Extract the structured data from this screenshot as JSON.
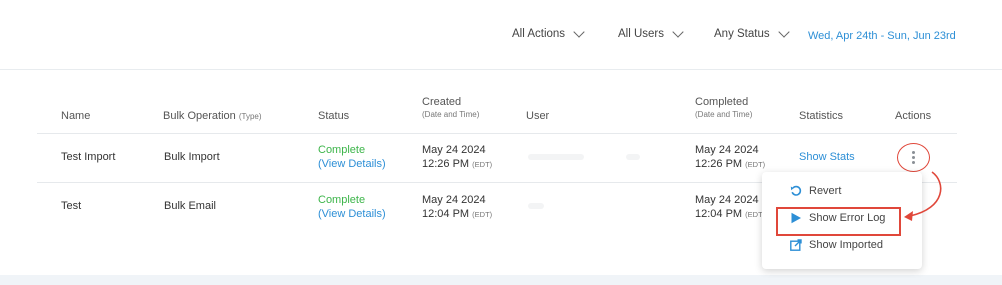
{
  "filters": {
    "actions": "All Actions",
    "users": "All Users",
    "status": "Any Status",
    "date_range": "Wed, Apr 24th - Sun, Jun 23rd"
  },
  "table": {
    "headers": {
      "name": "Name",
      "bulk_operation": "Bulk Operation",
      "bulk_operation_sub": "(Type)",
      "status": "Status",
      "created": "Created",
      "created_sub": "(Date and Time)",
      "user": "User",
      "completed": "Completed",
      "completed_sub": "(Date and Time)",
      "statistics": "Statistics",
      "actions": "Actions"
    },
    "rows": [
      {
        "name": "Test Import",
        "operation": "Bulk Import",
        "status": "Complete",
        "status_link": "(View Details)",
        "created_date": "May 24 2024",
        "created_time": "12:26 PM",
        "created_tz": "(EDT)",
        "completed_date": "May 24 2024",
        "completed_time": "12:26 PM",
        "completed_tz": "(EDT)",
        "statistics": "Show Stats"
      },
      {
        "name": "Test",
        "operation": "Bulk Email",
        "status": "Complete",
        "status_link": "(View Details)",
        "created_date": "May 24 2024",
        "created_time": "12:04 PM",
        "created_tz": "(EDT)",
        "completed_date": "May 24 2024",
        "completed_time": "12:04 PM",
        "completed_tz": "(EDT)"
      }
    ]
  },
  "actions_menu": {
    "items": [
      {
        "label": "Revert",
        "icon": "revert-icon"
      },
      {
        "label": "Show Error Log",
        "icon": "play-icon"
      },
      {
        "label": "Show Imported",
        "icon": "external-link-icon"
      }
    ]
  },
  "colors": {
    "accent": "#2d8fd6",
    "success": "#3db54a",
    "annotation": "#e0473a"
  }
}
